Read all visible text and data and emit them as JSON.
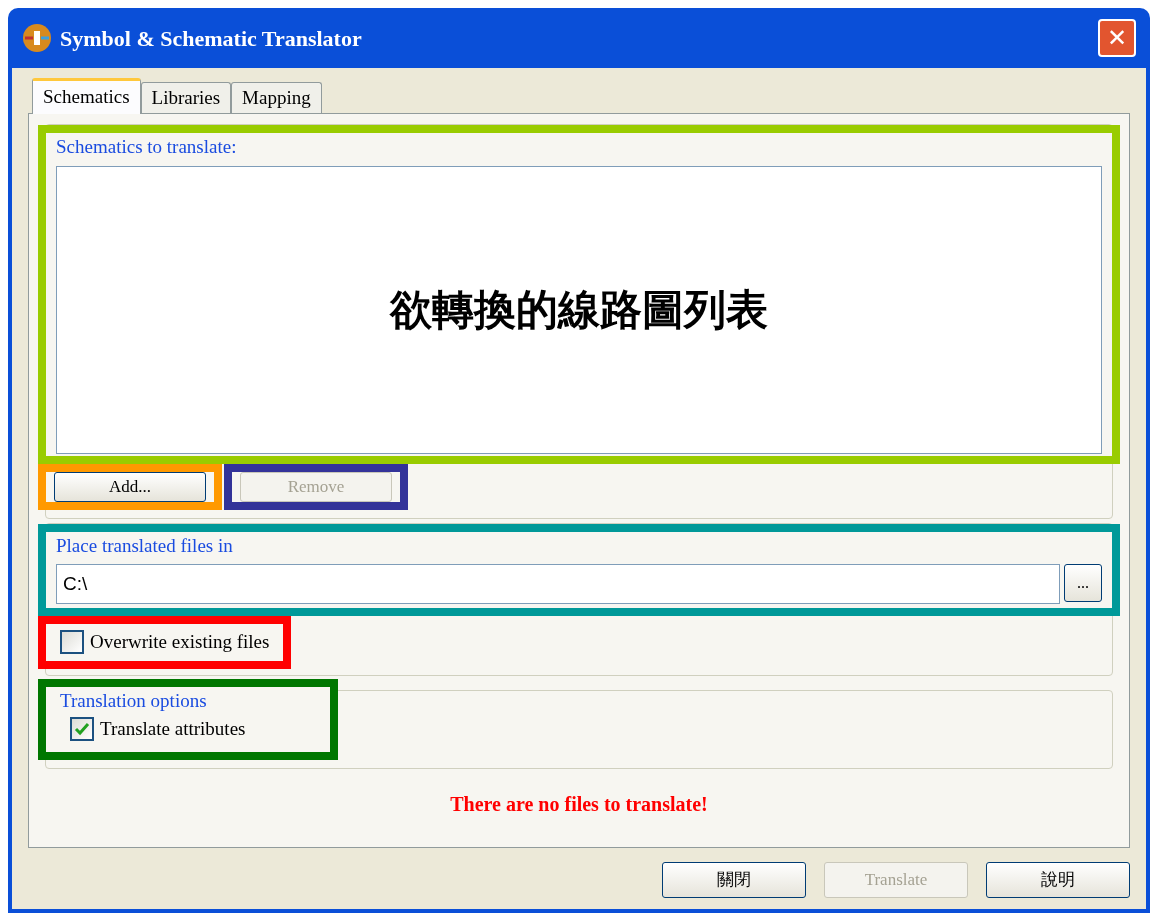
{
  "window": {
    "title": "Symbol & Schematic Translator",
    "close": "✕"
  },
  "tabs": [
    {
      "label": "Schematics",
      "selected": true
    },
    {
      "label": "Libraries",
      "selected": false
    },
    {
      "label": "Mapping",
      "selected": false
    }
  ],
  "schematics_group": {
    "legend": "Schematics to translate:",
    "color": "#99cc00",
    "list_caption": "欲轉換的線路圖列表",
    "buttons": [
      {
        "label": "Add...",
        "disabled": false,
        "color": "#ff9900"
      },
      {
        "label": "Remove",
        "disabled": true,
        "color": "#333399"
      }
    ]
  },
  "output_group": {
    "legend": "Place translated files in",
    "color": "#009999",
    "path": "C:\\",
    "browse": "..."
  },
  "overwrite": {
    "label": "Overwrite existing files",
    "checked": false,
    "color": "#ff0000"
  },
  "options_group": {
    "legend": "Translation options",
    "color": "#007700",
    "option": {
      "label": "Translate attributes",
      "checked": true
    }
  },
  "message": "There are no files to translate!",
  "footer_buttons": [
    {
      "label": "關閉",
      "disabled": false
    },
    {
      "label": "Translate",
      "disabled": true
    },
    {
      "label": "說明",
      "disabled": false
    }
  ]
}
